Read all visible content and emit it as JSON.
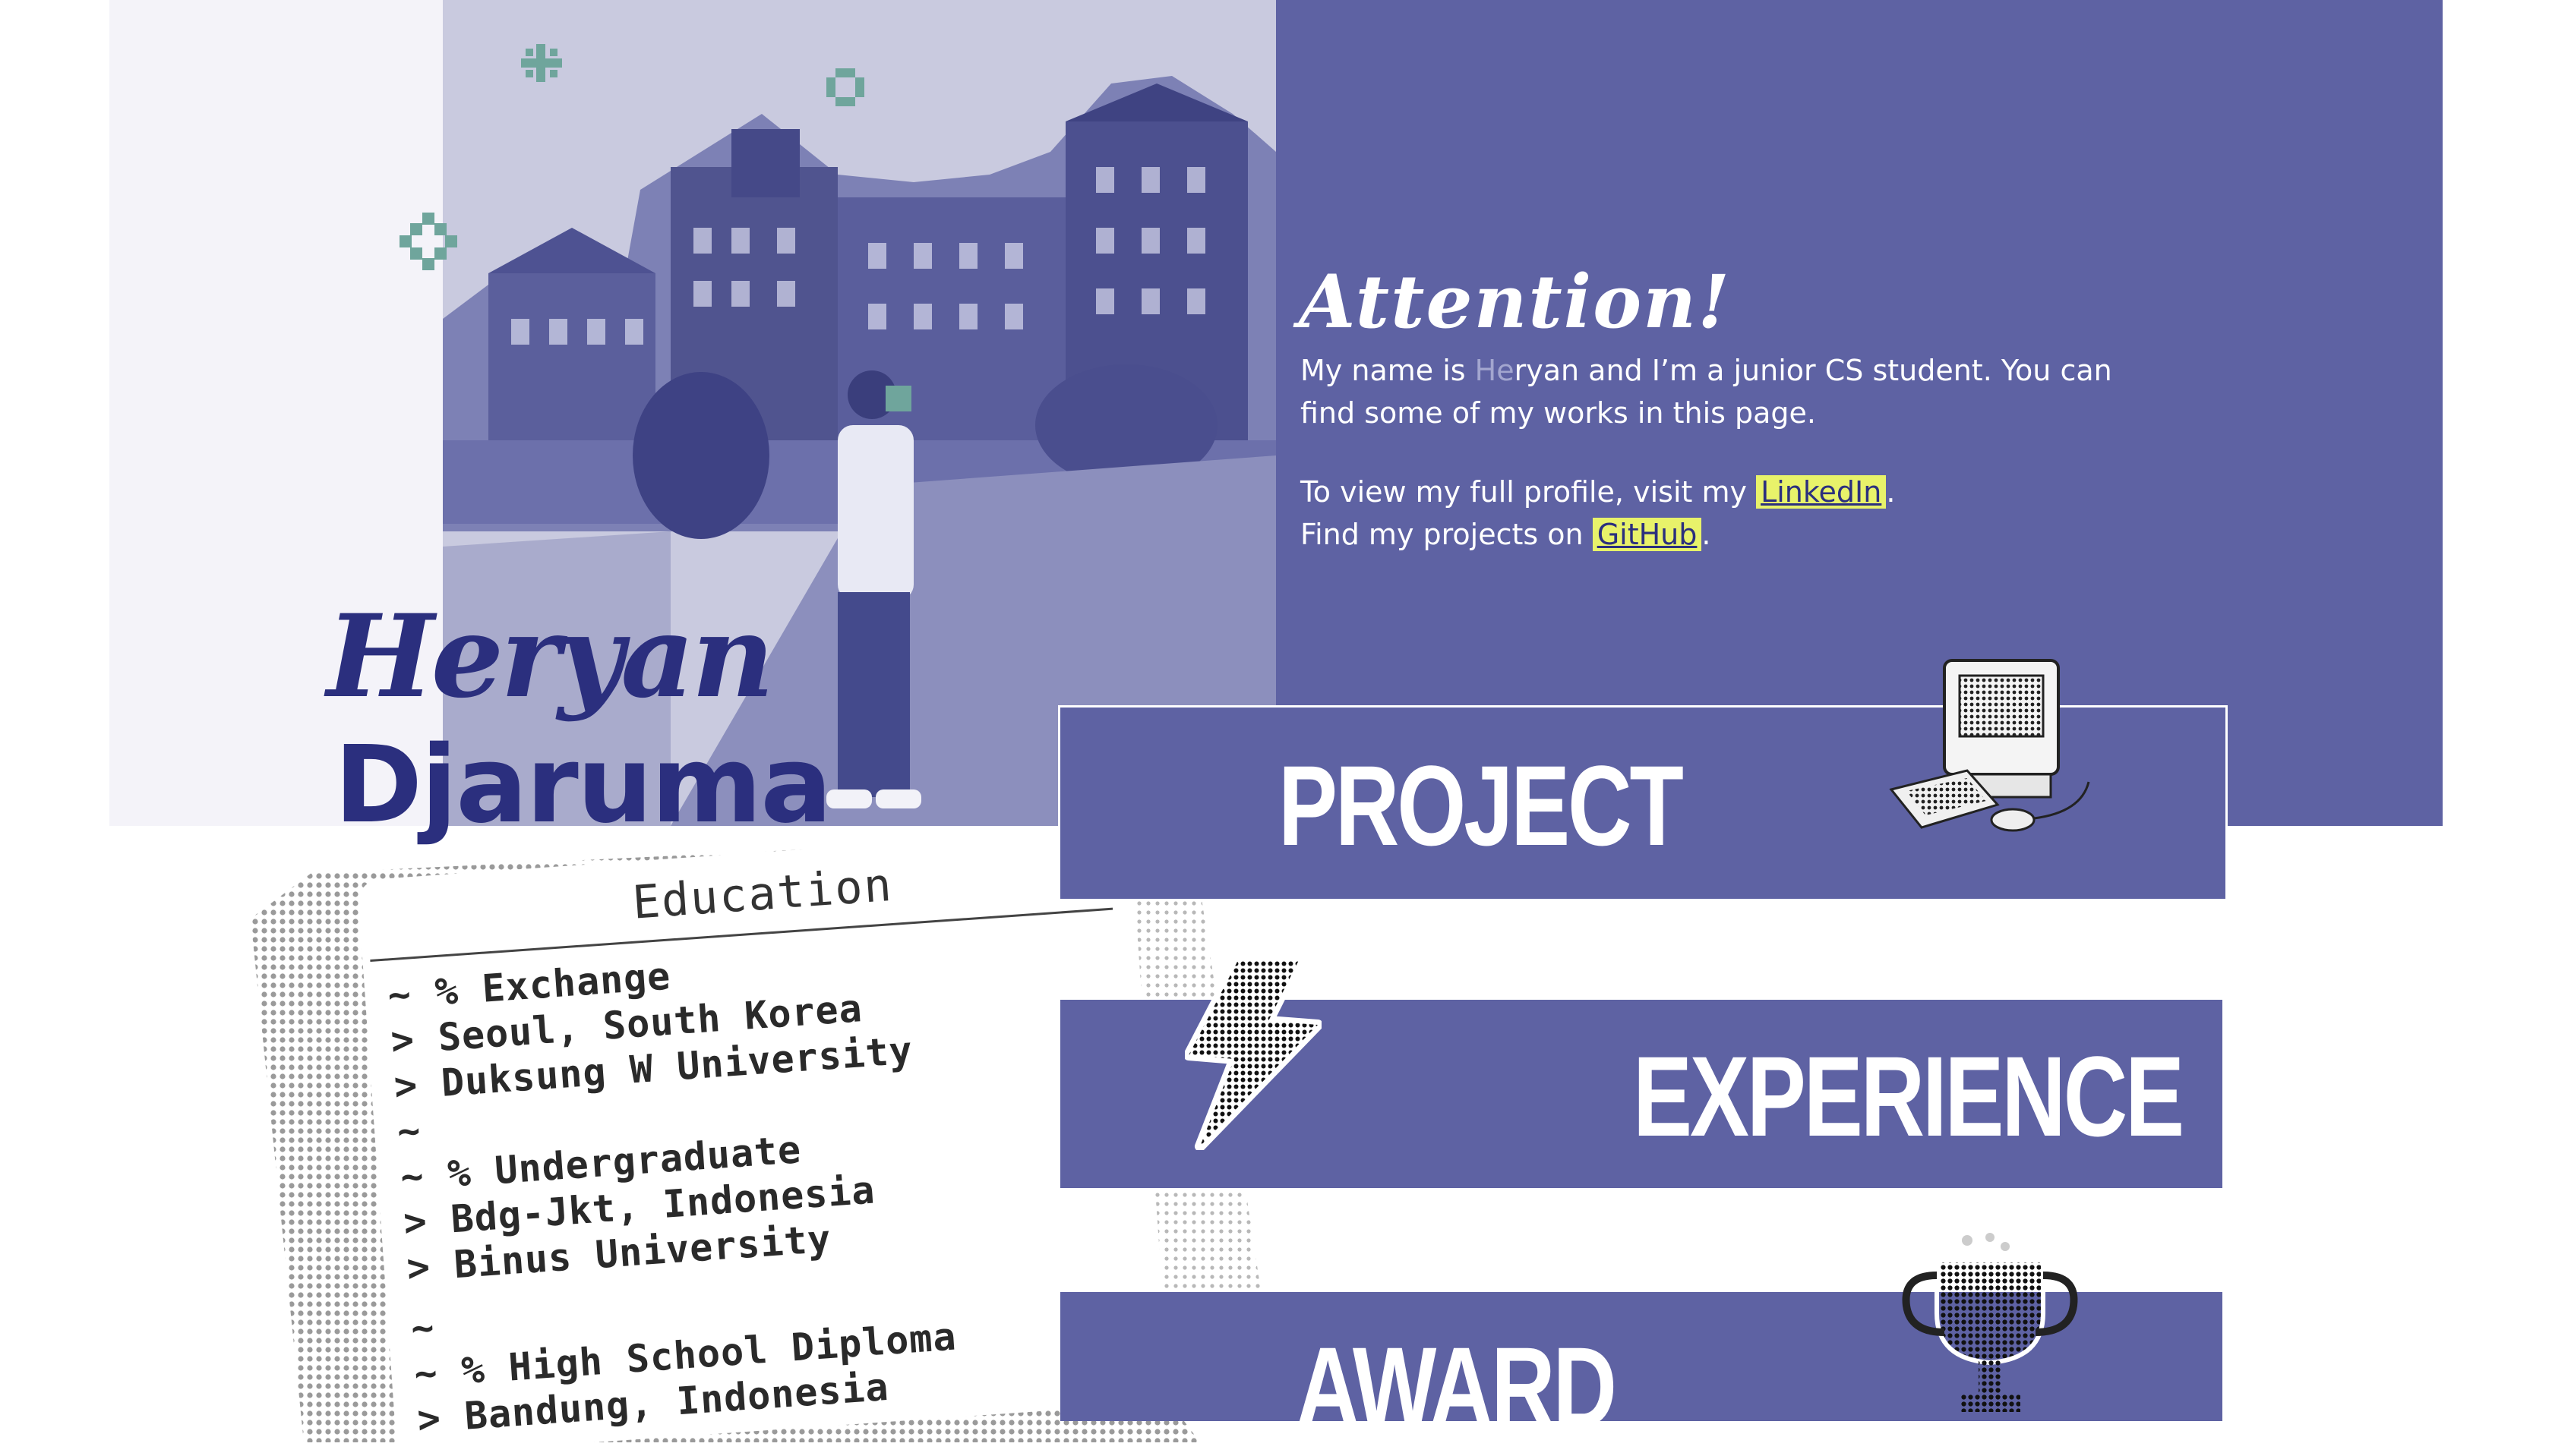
{
  "colors": {
    "accent_purple": "#5e62a3",
    "navy": "#2b2f7e",
    "highlight_yellow": "#e8f26a",
    "pixel_teal": "#6fa59c",
    "light_panel": "#f4f3f9"
  },
  "hero": {
    "first_name": "Heryan",
    "last_name": "Djaruma"
  },
  "intro": {
    "title": "Attention!",
    "p1_before": "My name is ",
    "p1_faded": "He",
    "p1_after": "ryan and I’m a junior CS student. You can find some of my works in this page.",
    "p2_line1_before": "To view my full profile, visit my ",
    "linkedin_label": "LinkedIn",
    "p2_line1_after": ".",
    "p2_line2_before": "Find my projects on ",
    "github_label": "GitHub",
    "p2_line2_after": "."
  },
  "sections": {
    "project": "PROJECT",
    "experience": "EXPERIENCE",
    "award": "AWARD"
  },
  "icons": {
    "computer": "computer-icon",
    "lightning": "lightning-icon",
    "trophy": "trophy-icon"
  },
  "education": {
    "title": "Education",
    "lines": [
      "~ % Exchange",
      "> Seoul, South Korea",
      "> Duksung W University",
      "~",
      "~ % Undergraduate",
      "> Bdg-Jkt, Indonesia",
      "> Binus University",
      "~",
      "~ % High School Diploma",
      "> Bandung, Indonesia"
    ]
  }
}
